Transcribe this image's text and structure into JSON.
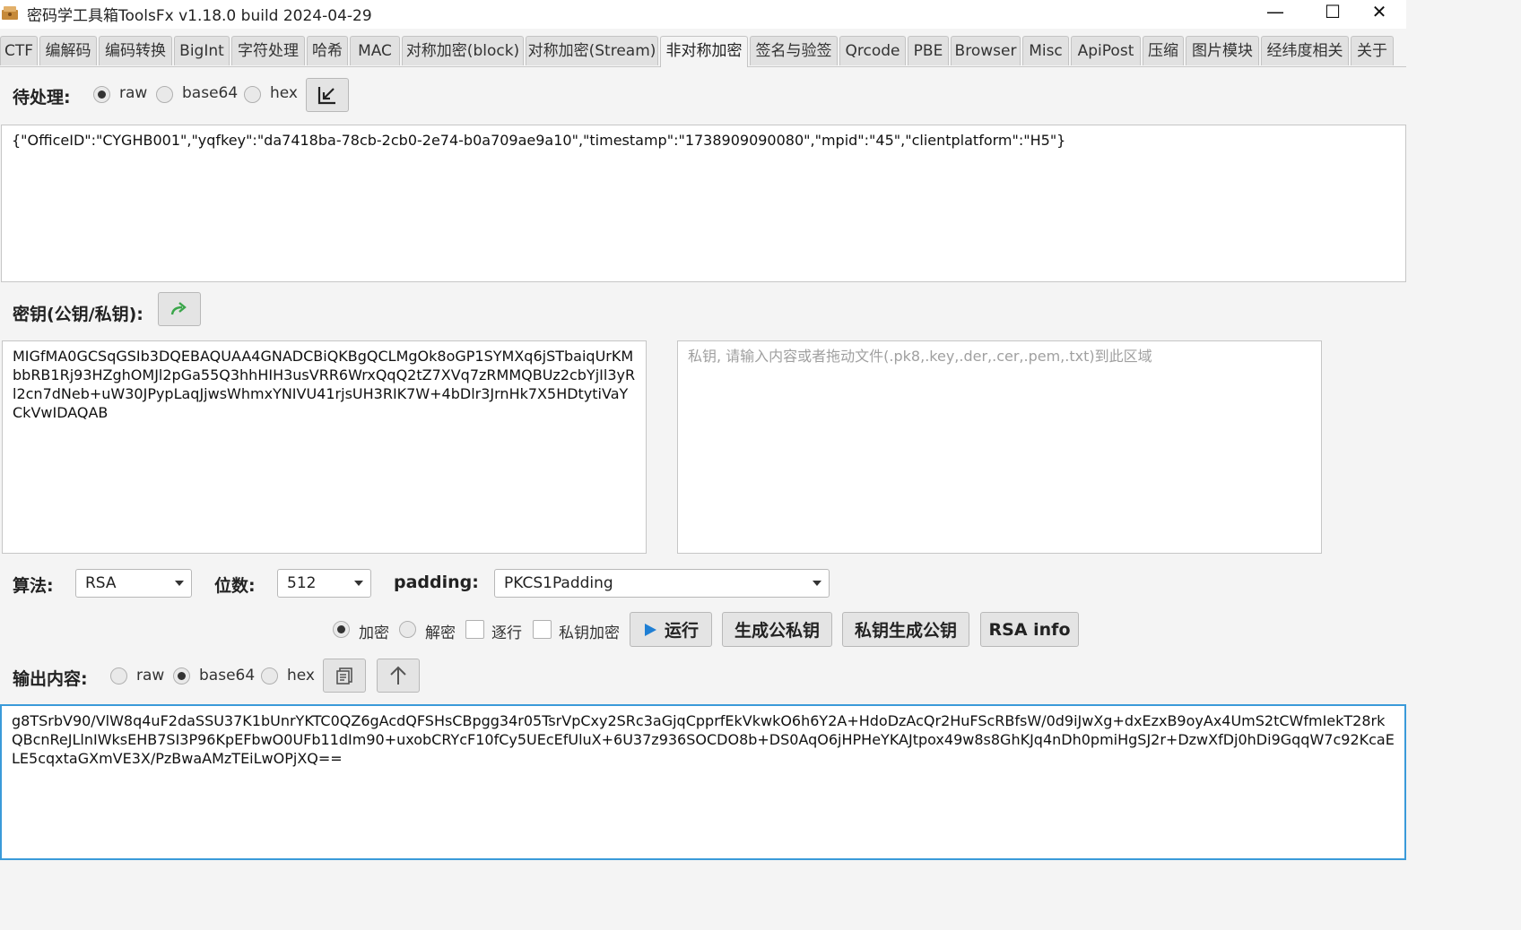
{
  "window": {
    "title": "密码学工具箱ToolsFx v1.18.0 build 2024-04-29",
    "minimize_glyph": "—",
    "maximize_glyph": "☐",
    "close_glyph": "✕"
  },
  "tabs": [
    {
      "label": "CTF"
    },
    {
      "label": "编解码"
    },
    {
      "label": "编码转换"
    },
    {
      "label": "BigInt"
    },
    {
      "label": "字符处理"
    },
    {
      "label": "哈希"
    },
    {
      "label": "MAC"
    },
    {
      "label": "对称加密(block)"
    },
    {
      "label": "对称加密(Stream)"
    },
    {
      "label": "非对称加密"
    },
    {
      "label": "签名与验签"
    },
    {
      "label": "Qrcode"
    },
    {
      "label": "PBE"
    },
    {
      "label": "Browser"
    },
    {
      "label": "Misc"
    },
    {
      "label": "ApiPost"
    },
    {
      "label": "压缩"
    },
    {
      "label": "图片模块"
    },
    {
      "label": "经纬度相关"
    },
    {
      "label": "关于"
    }
  ],
  "active_tab": "非对称加密",
  "input": {
    "label": "待处理:",
    "encodings": [
      "raw",
      "base64",
      "hex"
    ],
    "selected_encoding": "raw",
    "value": "{\"OfficeID\":\"CYGHB001\",\"yqfkey\":\"da7418ba-78cb-2cb0-2e74-b0a709ae9a10\",\"timestamp\":\"1738909090080\",\"mpid\":\"45\",\"clientplatform\":\"H5\"}",
    "import_icon": "import-arrow-icon"
  },
  "key": {
    "label": "密钥(公钥/私钥):",
    "swap_icon": "forward-arrow-icon",
    "public_key": "MIGfMA0GCSqGSIb3DQEBAQUAA4GNADCBiQKBgQCLMgOk8oGP1SYMXq6jSTbaiqUrKMbbRB1Rj93HZghOMJl2pGa55Q3hhHIH3usVRR6WrxQqQ2tZ7XVq7zRMMQBUz2cbYjIl3yRl2cn7dNeb+uW30JPypLaqJjwsWhmxYNIVU41rjsUH3RIK7W+4bDlr3JrnHk7X5HDtytiVaYCkVwIDAQAB",
    "private_key_placeholder": "私钥, 请输入内容或者拖动文件(.pk8,.key,.der,.cer,.pem,.txt)到此区域"
  },
  "options": {
    "algo_label": "算法:",
    "algo_value": "RSA",
    "bits_label": "位数:",
    "bits_value": "512",
    "padding_label": "padding:",
    "padding_value": "PKCS1Padding"
  },
  "actions": {
    "encrypt_label": "加密",
    "decrypt_label": "解密",
    "mode_selected": "加密",
    "line_by_line_label": "逐行",
    "private_encrypt_label": "私钥加密",
    "run_label": "运行",
    "gen_keypair_label": "生成公私钥",
    "priv_to_pub_label": "私钥生成公钥",
    "rsa_info_label": "RSA info"
  },
  "output": {
    "label": "输出内容:",
    "encodings": [
      "raw",
      "base64",
      "hex"
    ],
    "selected_encoding": "base64",
    "copy_icon": "copy-icon",
    "up_icon": "up-arrow-icon",
    "value": "g8TSrbV90/VlW8q4uF2daSSU37K1bUnrYKTC0QZ6gAcdQFSHsCBpgg34r05TsrVpCxy2SRc3aGjqCpprfEkVkwkO6h6Y2A+HdoDzAcQr2HuFScRBfsW/0d9iJwXg+dxEzxB9oyAx4UmS2tCWfmIekT28rkQBcnReJLlnIWksEHB7SI3P96KpEFbwO0UFb11dIm90+uxobCRYcF10fCy5UEcEfUluX+6U37z936SOCDO8b+DS0AqO6jHPHeYKAJtpox49w8s8GhKJq4nDh0pmiHgSJ2r+DzwXfDj0hDi9GqqW7c92KcaELE5cqxtaGXmVE3X/PzBwaAMzTEiLwOPjXQ=="
  }
}
